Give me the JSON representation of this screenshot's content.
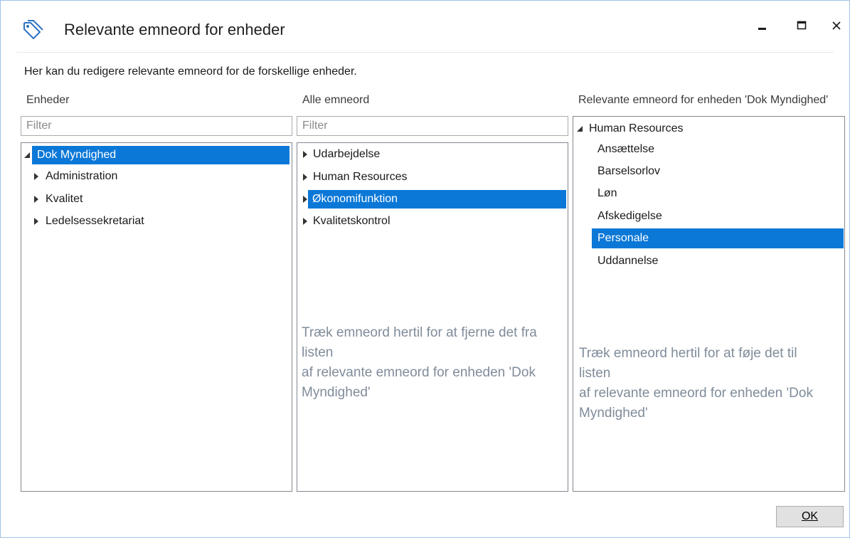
{
  "window": {
    "title": "Relevante emneord for enheder",
    "icon": "tag-icon",
    "controls": {
      "minimize": "minimize-icon",
      "maximize": "maximize-icon",
      "close": "close-icon"
    }
  },
  "description": "Her kan du redigere relevante emneord for de forskellige enheder.",
  "units_panel": {
    "label": "Enheder",
    "filter_placeholder": "Filter",
    "root": "Dok Myndighed",
    "children": [
      "Administration",
      "Kvalitet",
      "Ledelsessekretariat"
    ],
    "selected": "Dok Myndighed"
  },
  "all_keywords_panel": {
    "label": "Alle emneord",
    "filter_placeholder": "Filter",
    "items": [
      "Udarbejdelse",
      "Human Resources",
      "Økonomifunktion",
      "Kvalitetskontrol"
    ],
    "selected": "Økonomifunktion",
    "hint_lines": [
      "Træk emneord hertil for at fjerne det fra",
      "listen",
      "af relevante emneord for enheden 'Dok",
      "Myndighed'"
    ]
  },
  "relevant_keywords_panel": {
    "label": "Relevante emneord for enheden 'Dok Myndighed'",
    "root": "Human Resources",
    "children": [
      "Ansættelse",
      "Barselsorlov",
      "Løn",
      "Afskedigelse",
      "Personale",
      "Uddannelse"
    ],
    "selected": "Personale",
    "hint_lines": [
      "Træk emneord hertil for at føje det til",
      "listen",
      "af relevante emneord for enheden 'Dok",
      "Myndighed'"
    ]
  },
  "ok_button": {
    "label": "OK"
  },
  "colors": {
    "selection": "#0b78d7",
    "hint_text": "#7f8c9a",
    "border": "#828790"
  }
}
